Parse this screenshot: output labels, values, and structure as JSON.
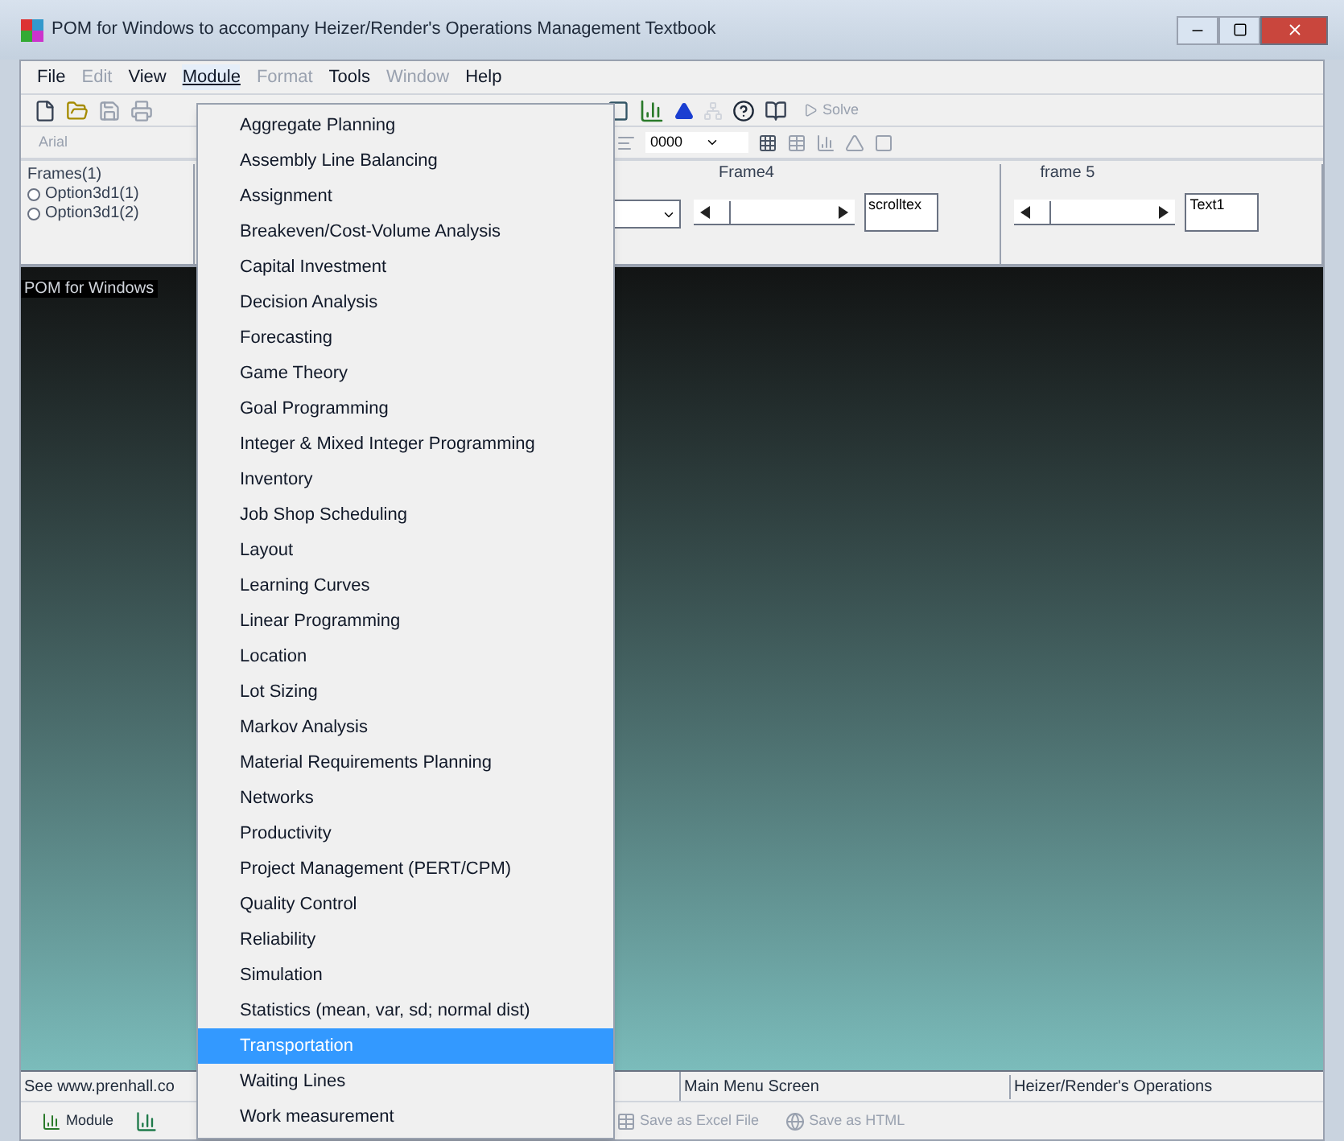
{
  "window": {
    "title": "POM for Windows to accompany Heizer/Render's Operations Management Textbook"
  },
  "menu_bar": [
    {
      "label": "File",
      "disabled": false,
      "selected": false
    },
    {
      "label": "Edit",
      "disabled": true,
      "selected": false
    },
    {
      "label": "View",
      "disabled": false,
      "selected": false
    },
    {
      "label": "Module",
      "disabled": false,
      "selected": true
    },
    {
      "label": "Format",
      "disabled": true,
      "selected": false
    },
    {
      "label": "Tools",
      "disabled": false,
      "selected": false
    },
    {
      "label": "Window",
      "disabled": true,
      "selected": false
    },
    {
      "label": "Help",
      "disabled": false,
      "selected": false
    }
  ],
  "module_menu": [
    {
      "label": "Aggregate Planning",
      "selected": false
    },
    {
      "label": "Assembly Line Balancing",
      "selected": false
    },
    {
      "label": "Assignment",
      "selected": false
    },
    {
      "label": "Breakeven/Cost-Volume Analysis",
      "selected": false
    },
    {
      "label": "Capital Investment",
      "selected": false
    },
    {
      "label": "Decision Analysis",
      "selected": false
    },
    {
      "label": "Forecasting",
      "selected": false
    },
    {
      "label": "Game Theory",
      "selected": false
    },
    {
      "label": "Goal Programming",
      "selected": false
    },
    {
      "label": "Integer & Mixed Integer Programming",
      "selected": false
    },
    {
      "label": "Inventory",
      "selected": false
    },
    {
      "label": "Job Shop Scheduling",
      "selected": false
    },
    {
      "label": "Layout",
      "selected": false
    },
    {
      "label": "Learning Curves",
      "selected": false
    },
    {
      "label": "Linear Programming",
      "selected": false
    },
    {
      "label": "Location",
      "selected": false
    },
    {
      "label": "Lot Sizing",
      "selected": false
    },
    {
      "label": "Markov Analysis",
      "selected": false
    },
    {
      "label": "Material Requirements Planning",
      "selected": false
    },
    {
      "label": "Networks",
      "selected": false
    },
    {
      "label": "Productivity",
      "selected": false
    },
    {
      "label": "Project Management (PERT/CPM)",
      "selected": false
    },
    {
      "label": "Quality Control",
      "selected": false
    },
    {
      "label": "Reliability",
      "selected": false
    },
    {
      "label": "Simulation",
      "selected": false
    },
    {
      "label": "Statistics (mean, var, sd; normal dist)",
      "selected": false
    },
    {
      "label": "Transportation",
      "selected": true
    },
    {
      "label": "Waiting Lines",
      "selected": false
    },
    {
      "label": "Work measurement",
      "selected": false
    }
  ],
  "toolbar": {
    "solve_button": {
      "label": "Solve",
      "disabled": true
    },
    "font_field": {
      "value": "Arial",
      "disabled": true
    },
    "format_field": {
      "value": "0000"
    }
  },
  "frames": [
    {
      "kind": "radio",
      "title": "Frames(1)",
      "options": [
        {
          "label": "Option3d1(1)",
          "selected": false
        },
        {
          "label": "Option3d1(2)",
          "selected": false
        }
      ]
    },
    {
      "kind": "scroll",
      "title": "Frame4",
      "text": "scrolltex"
    },
    {
      "kind": "scroll",
      "title": "frame 5",
      "text": "Text1"
    }
  ],
  "main_area": {
    "title": "POM for Windows"
  },
  "status_bar": [
    "See www.prenhall.co",
    "Main Menu Screen",
    "Heizer/Render's Operations"
  ],
  "bottom_toolbar": [
    {
      "label": "Module",
      "disabled": false
    },
    {
      "label": "Save as Excel File",
      "disabled": true
    },
    {
      "label": "Save as HTML",
      "disabled": true
    }
  ]
}
